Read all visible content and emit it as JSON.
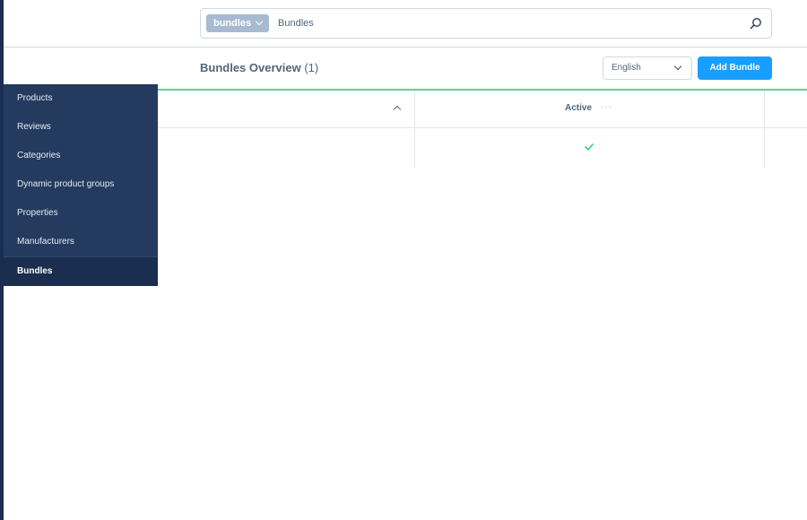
{
  "search": {
    "type_label": "bundles",
    "value": "Bundles"
  },
  "smartbar": {
    "title": "Bundles Overview",
    "count": "(1)",
    "language": "English",
    "add_label": "Add Bundle"
  },
  "grid": {
    "columns": [
      {
        "label": "",
        "sortable": true
      },
      {
        "label": "Active",
        "menu": "···"
      }
    ],
    "rows": [
      {
        "active": true
      }
    ]
  },
  "nav": {
    "items": [
      {
        "label": "Products"
      },
      {
        "label": "Reviews"
      },
      {
        "label": "Categories"
      },
      {
        "label": "Dynamic product groups"
      },
      {
        "label": "Properties"
      },
      {
        "label": "Manufacturers"
      },
      {
        "label": "Bundles",
        "active": true
      }
    ]
  },
  "colors": {
    "accent": "#189eff",
    "sidebar": "#243a5e",
    "sidebar_active": "#1b2e4f",
    "success": "#37d07e"
  }
}
